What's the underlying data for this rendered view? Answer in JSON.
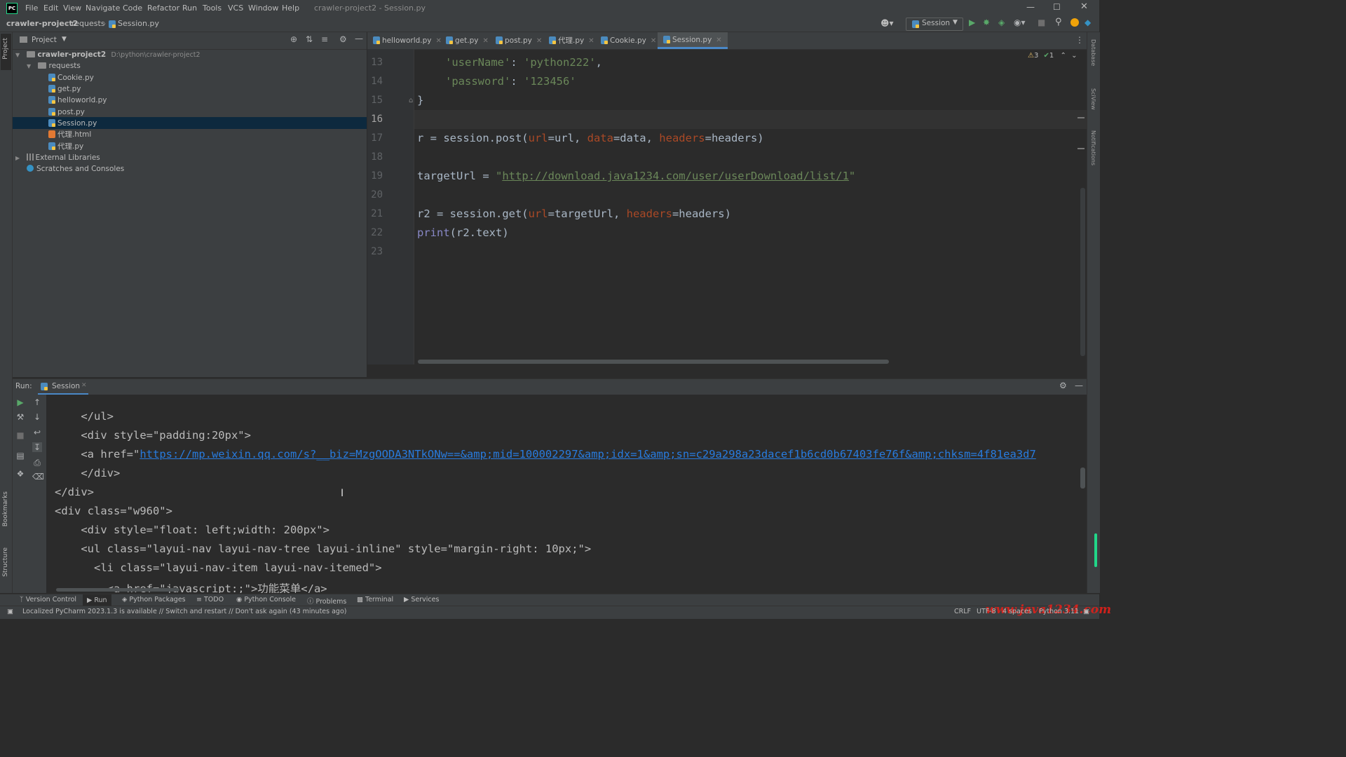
{
  "app": {
    "logo": "PC",
    "menu": [
      "File",
      "Edit",
      "View",
      "Navigate",
      "Code",
      "Refactor",
      "Run",
      "Tools",
      "VCS",
      "Window",
      "Help"
    ],
    "window_title": "crawler-project2 - Session.py"
  },
  "breadcrumb": [
    "crawler-project2",
    "requests",
    "Session.py"
  ],
  "run_config": "Session",
  "side_labels": {
    "project": "Project",
    "bookmarks": "Bookmarks",
    "structure": "Structure",
    "database": "Database",
    "sciview": "SciView",
    "notifications": "Notifications"
  },
  "project_panel": {
    "title": "Project",
    "root_name": "crawler-project2",
    "root_path": "D:\\python\\crawler-project2",
    "folder": "requests",
    "files": [
      "Cookie.py",
      "get.py",
      "helloworld.py",
      "post.py",
      "Session.py",
      "代理.html",
      "代理.py"
    ],
    "selected": "Session.py",
    "external": "External Libraries",
    "scratches": "Scratches and Consoles"
  },
  "tabs": [
    "helloworld.py",
    "get.py",
    "post.py",
    "代理.py",
    "Cookie.py",
    "Session.py"
  ],
  "active_tab": "Session.py",
  "inspections": {
    "warnings": "3",
    "ok": "1"
  },
  "editor": {
    "line_numbers": [
      "13",
      "14",
      "15",
      "16",
      "17",
      "18",
      "19",
      "20",
      "21",
      "22",
      "23"
    ],
    "l13_key": "'userName'",
    "l13_val": "'python222'",
    "l14_key": "'password'",
    "l14_val": "'123456'",
    "l15": "}",
    "l17_a": "r = session.post(",
    "l17_p1": "url",
    "l17_b": "=url, ",
    "l17_p2": "data",
    "l17_c": "=data, ",
    "l17_p3": "headers",
    "l17_d": "=headers)",
    "l19_a": "targetUrl = ",
    "l19_q1": "\"",
    "l19_url": "http://download.java1234.com/user/userDownload/list/1",
    "l19_q2": "\"",
    "l21_a": "r2 = session.get(",
    "l21_p1": "url",
    "l21_b": "=targetUrl, ",
    "l21_p2": "headers",
    "l21_c": "=headers)",
    "l22_fn": "print",
    "l22_rest": "(r2.text)"
  },
  "run_panel": {
    "label": "Run:",
    "tab": "Session",
    "lines": [
      "    </ul>",
      "    <div style=\"padding:20px\">",
      "    <a href=\"",
      "    </div>",
      "</div>",
      "<div class=\"w960\">",
      "    <div style=\"float: left;width: 200px\">",
      "    <ul class=\"layui-nav layui-nav-tree layui-inline\" style=\"margin-right: 10px;\">",
      "      <li class=\"layui-nav-item layui-nav-itemed\">",
      "        <a href=\"javascript:;\">功能菜单</a>"
    ],
    "link": "https://mp.weixin.qq.com/s?__biz=MzgOODA3NTkONw==&amp;mid=100002297&amp;idx=1&amp;sn=c29a298a23dacef1b6cd0b67403fe76f&amp;chksm=4f81ea3d7"
  },
  "bottom_tools": [
    "Version Control",
    "Run",
    "Python Packages",
    "TODO",
    "Python Console",
    "Problems",
    "Terminal",
    "Services"
  ],
  "status": {
    "message": "Localized PyCharm 2023.1.3 is available // Switch and restart // Don't ask again (43 minutes ago)",
    "line_sep": "CRLF",
    "encoding": "UTF-8",
    "indent": "4 spaces",
    "interpreter": "Python 3.11",
    "watermark": "www.java1234.com"
  }
}
